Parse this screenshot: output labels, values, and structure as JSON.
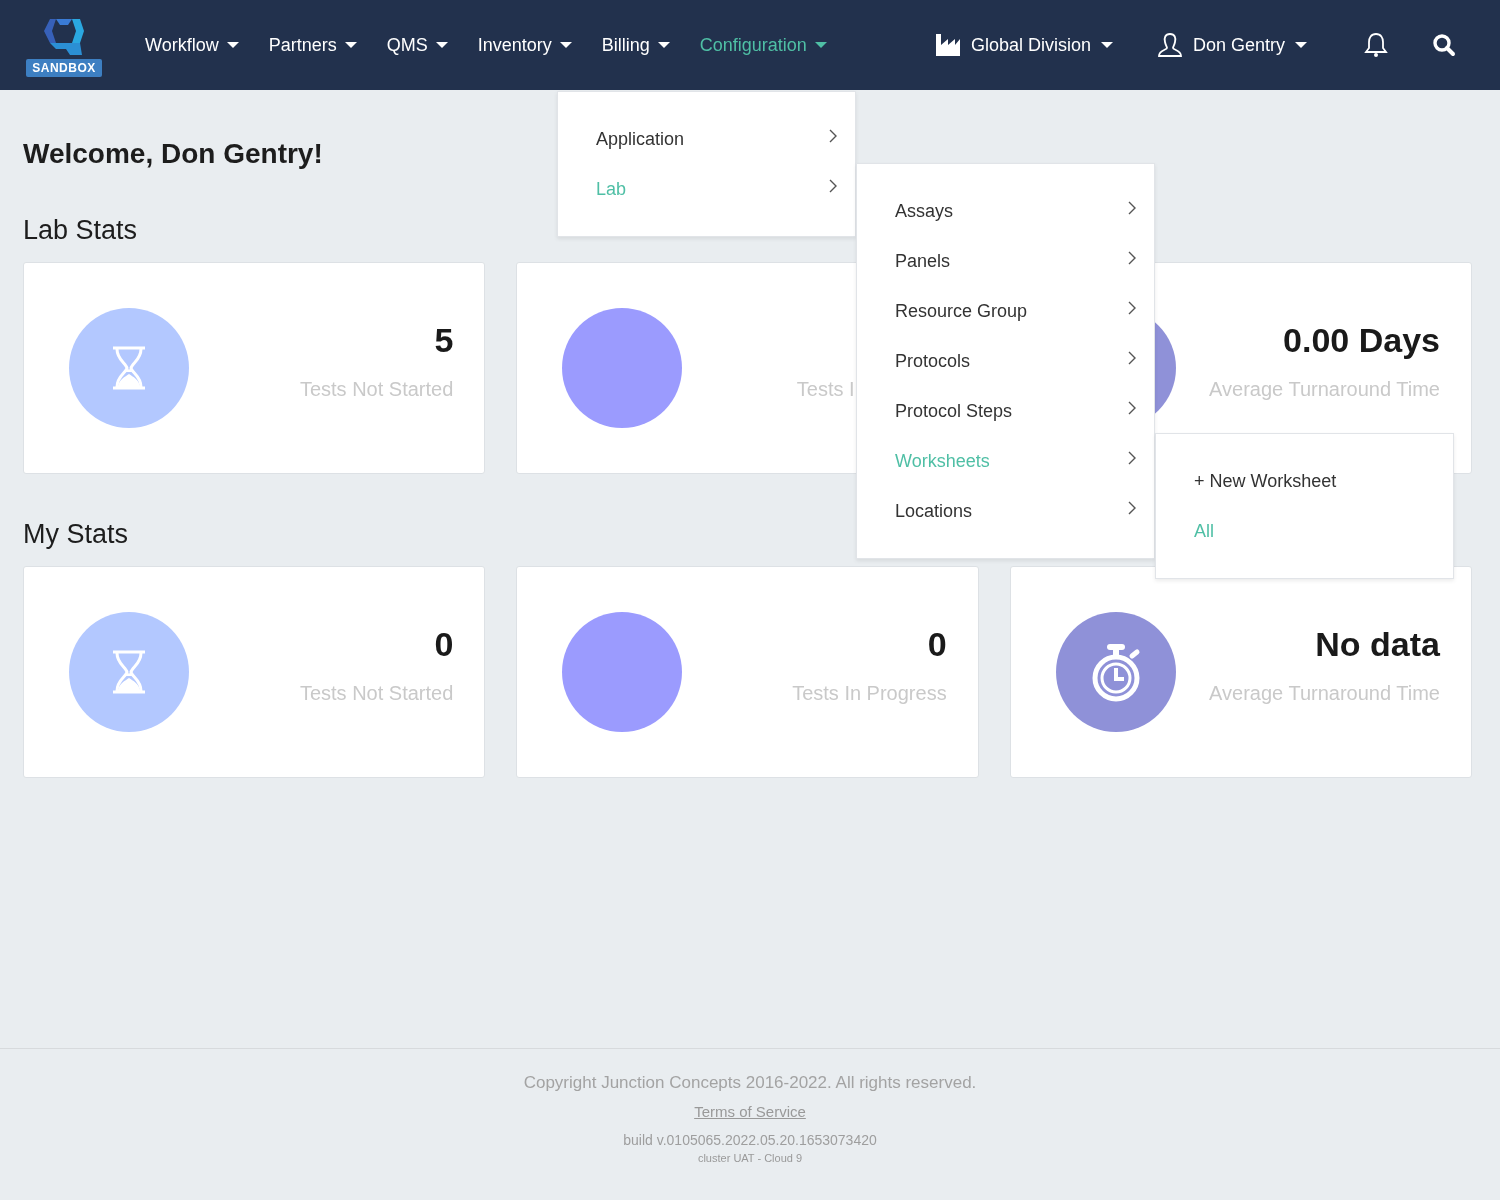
{
  "nav": {
    "logo_badge": "SANDBOX",
    "items": [
      {
        "label": "Workflow",
        "selected": false
      },
      {
        "label": "Partners",
        "selected": false
      },
      {
        "label": "QMS",
        "selected": false
      },
      {
        "label": "Inventory",
        "selected": false
      },
      {
        "label": "Billing",
        "selected": false
      },
      {
        "label": "Configuration",
        "selected": true
      }
    ],
    "division": "Global Division",
    "user": "Don Gentry"
  },
  "welcome": "Welcome, Don Gentry!",
  "sections": [
    {
      "title": "Lab Stats",
      "cards": [
        {
          "kind": "not_started",
          "value": "5",
          "label": "Tests Not Started"
        },
        {
          "kind": "in_progress",
          "label": "Tests I"
        },
        {
          "kind": "turnaround",
          "value": "0.00 Days",
          "label": "Average Turnaround Time"
        }
      ]
    },
    {
      "title": "My Stats",
      "cards": [
        {
          "kind": "not_started",
          "value": "0",
          "label": "Tests Not Started"
        },
        {
          "kind": "in_progress",
          "value": "0",
          "label": "Tests In Progress"
        },
        {
          "kind": "turnaround",
          "value": "No data",
          "label": "Average Turnaround Time"
        }
      ]
    }
  ],
  "menus": [
    {
      "items": [
        {
          "label": "Application",
          "selected": false,
          "submenu": true
        },
        {
          "label": "Lab",
          "selected": true,
          "submenu": true
        }
      ]
    },
    {
      "items": [
        {
          "label": "Assays",
          "selected": false,
          "submenu": true
        },
        {
          "label": "Panels",
          "selected": false,
          "submenu": true
        },
        {
          "label": "Resource Group",
          "selected": false,
          "submenu": true
        },
        {
          "label": "Protocols",
          "selected": false,
          "submenu": true
        },
        {
          "label": "Protocol Steps",
          "selected": false,
          "submenu": true
        },
        {
          "label": "Worksheets",
          "selected": true,
          "submenu": true
        },
        {
          "label": "Locations",
          "selected": false,
          "submenu": true
        }
      ]
    },
    {
      "items": [
        {
          "label": "+ New Worksheet",
          "selected": false,
          "submenu": false
        },
        {
          "label": "All",
          "selected": true,
          "submenu": false
        }
      ]
    }
  ],
  "footer": {
    "copyright": "Copyright Junction Concepts 2016-2022. All rights reserved.",
    "terms": "Terms of Service",
    "build": "build v.0105065.2022.05.20.1653073420",
    "cluster": "cluster UAT - Cloud 9"
  }
}
